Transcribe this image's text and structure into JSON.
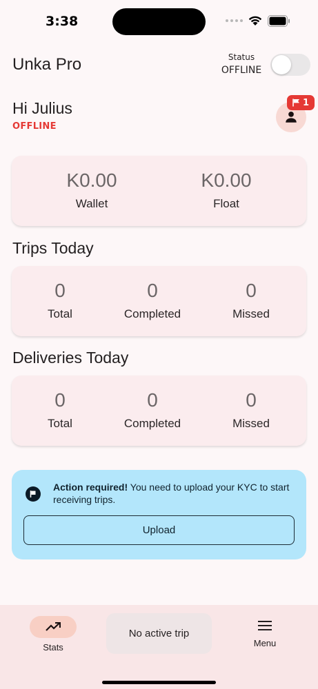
{
  "status_bar": {
    "time": "3:38"
  },
  "header": {
    "app_title": "Unka Pro",
    "status_label": "Status",
    "status_value": "OFFLINE",
    "toggle_on": false
  },
  "user": {
    "greeting": "Hi Julius",
    "state": "OFFLINE",
    "notification_count": "1"
  },
  "balances": {
    "wallet_value": "K0.00",
    "wallet_label": "Wallet",
    "float_value": "K0.00",
    "float_label": "Float"
  },
  "trips": {
    "title": "Trips Today",
    "total_value": "0",
    "total_label": "Total",
    "completed_value": "0",
    "completed_label": "Completed",
    "missed_value": "0",
    "missed_label": "Missed"
  },
  "deliveries": {
    "title": "Deliveries Today",
    "total_value": "0",
    "total_label": "Total",
    "completed_value": "0",
    "completed_label": "Completed",
    "missed_value": "0",
    "missed_label": "Missed"
  },
  "kyc": {
    "title": "Action required!",
    "message": " You need to upload your KYC to start receiving trips.",
    "button_label": "Upload"
  },
  "bottom_nav": {
    "stats_label": "Stats",
    "trip_label": "No active trip",
    "menu_label": "Menu"
  },
  "colors": {
    "accent_red": "#e53935",
    "card_bg": "#fbecee",
    "kyc_bg": "#b3e6fb",
    "nav_active": "#f8cfc4"
  }
}
